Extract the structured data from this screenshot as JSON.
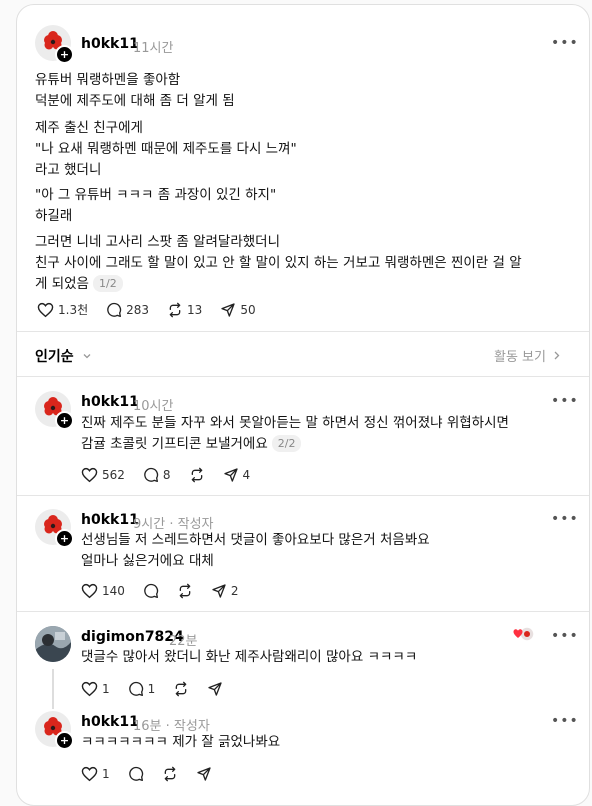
{
  "post": {
    "username": "h0kk11",
    "time": "11시간",
    "paragraphs": [
      "유튜버 뭐랭하멘을 좋아함\n덕분에 제주도에 대해 좀 더 알게 됨",
      "제주 출신 친구에게\n\"나 요새 뭐랭하멘 때문에 제주도를 다시 느껴\"\n라고 했더니",
      "\"아 그 유튜버 ㅋㅋㅋ 좀 과장이 있긴 하지\"\n하길래",
      "그러면 니네 고사리 스팟 좀 알려달라했더니\n친구 사이에 그래도 할 말이 있고 안 할 말이 있지 하는 거보고 뭐랭하멘은 찐이란 걸 알\n게 되었음"
    ],
    "pager": "1/2",
    "likes": "1.3천",
    "comments": "283",
    "reposts": "13",
    "shares": "50"
  },
  "sort": {
    "label": "인기순",
    "activity": "활동 보기"
  },
  "replies": [
    {
      "username": "h0kk11",
      "time": "10시간",
      "tag": "",
      "text": "진짜 제주도 분들 자꾸 와서 못알아듣는 말 하면서 정신 꺾어졌냐 위협하시면\n감귤 초콜릿 기프티콘 보낼거에요",
      "pager": "2/2",
      "likes": "562",
      "comments": "8",
      "reposts": "",
      "shares": "4"
    },
    {
      "username": "h0kk11",
      "time": "9시간",
      "tag": "· 작성자",
      "text": "선생님들 저 스레드하면서 댓글이 좋아요보다 많은거 처음봐요\n얼마나 싫은거에요 대체",
      "pager": "",
      "likes": "140",
      "comments": "",
      "reposts": "",
      "shares": "2"
    },
    {
      "username": "digimon7824",
      "time": "22분",
      "tag": "",
      "text": "댓글수 많아서 왔더니 화난 제주사람왜리이 많아요 ㅋㅋㅋㅋ",
      "pager": "",
      "likes": "1",
      "comments": "1",
      "reposts": "",
      "shares": ""
    },
    {
      "username": "h0kk11",
      "time": "16분",
      "tag": "· 작성자",
      "text": "ㅋㅋㅋㅋㅋㅋㅋ 제가 잘 긁었나봐요",
      "pager": "",
      "likes": "1",
      "comments": "",
      "reposts": "",
      "shares": ""
    }
  ],
  "colors": {
    "flower": "#d9261c",
    "flower_center": "#2a1a1a",
    "avatar_bg": "#ececec"
  },
  "icons": [
    "more-icon",
    "heart-icon",
    "comment-icon",
    "repost-icon",
    "share-icon",
    "chevron-down-icon",
    "chevron-right-icon",
    "plus-icon"
  ]
}
